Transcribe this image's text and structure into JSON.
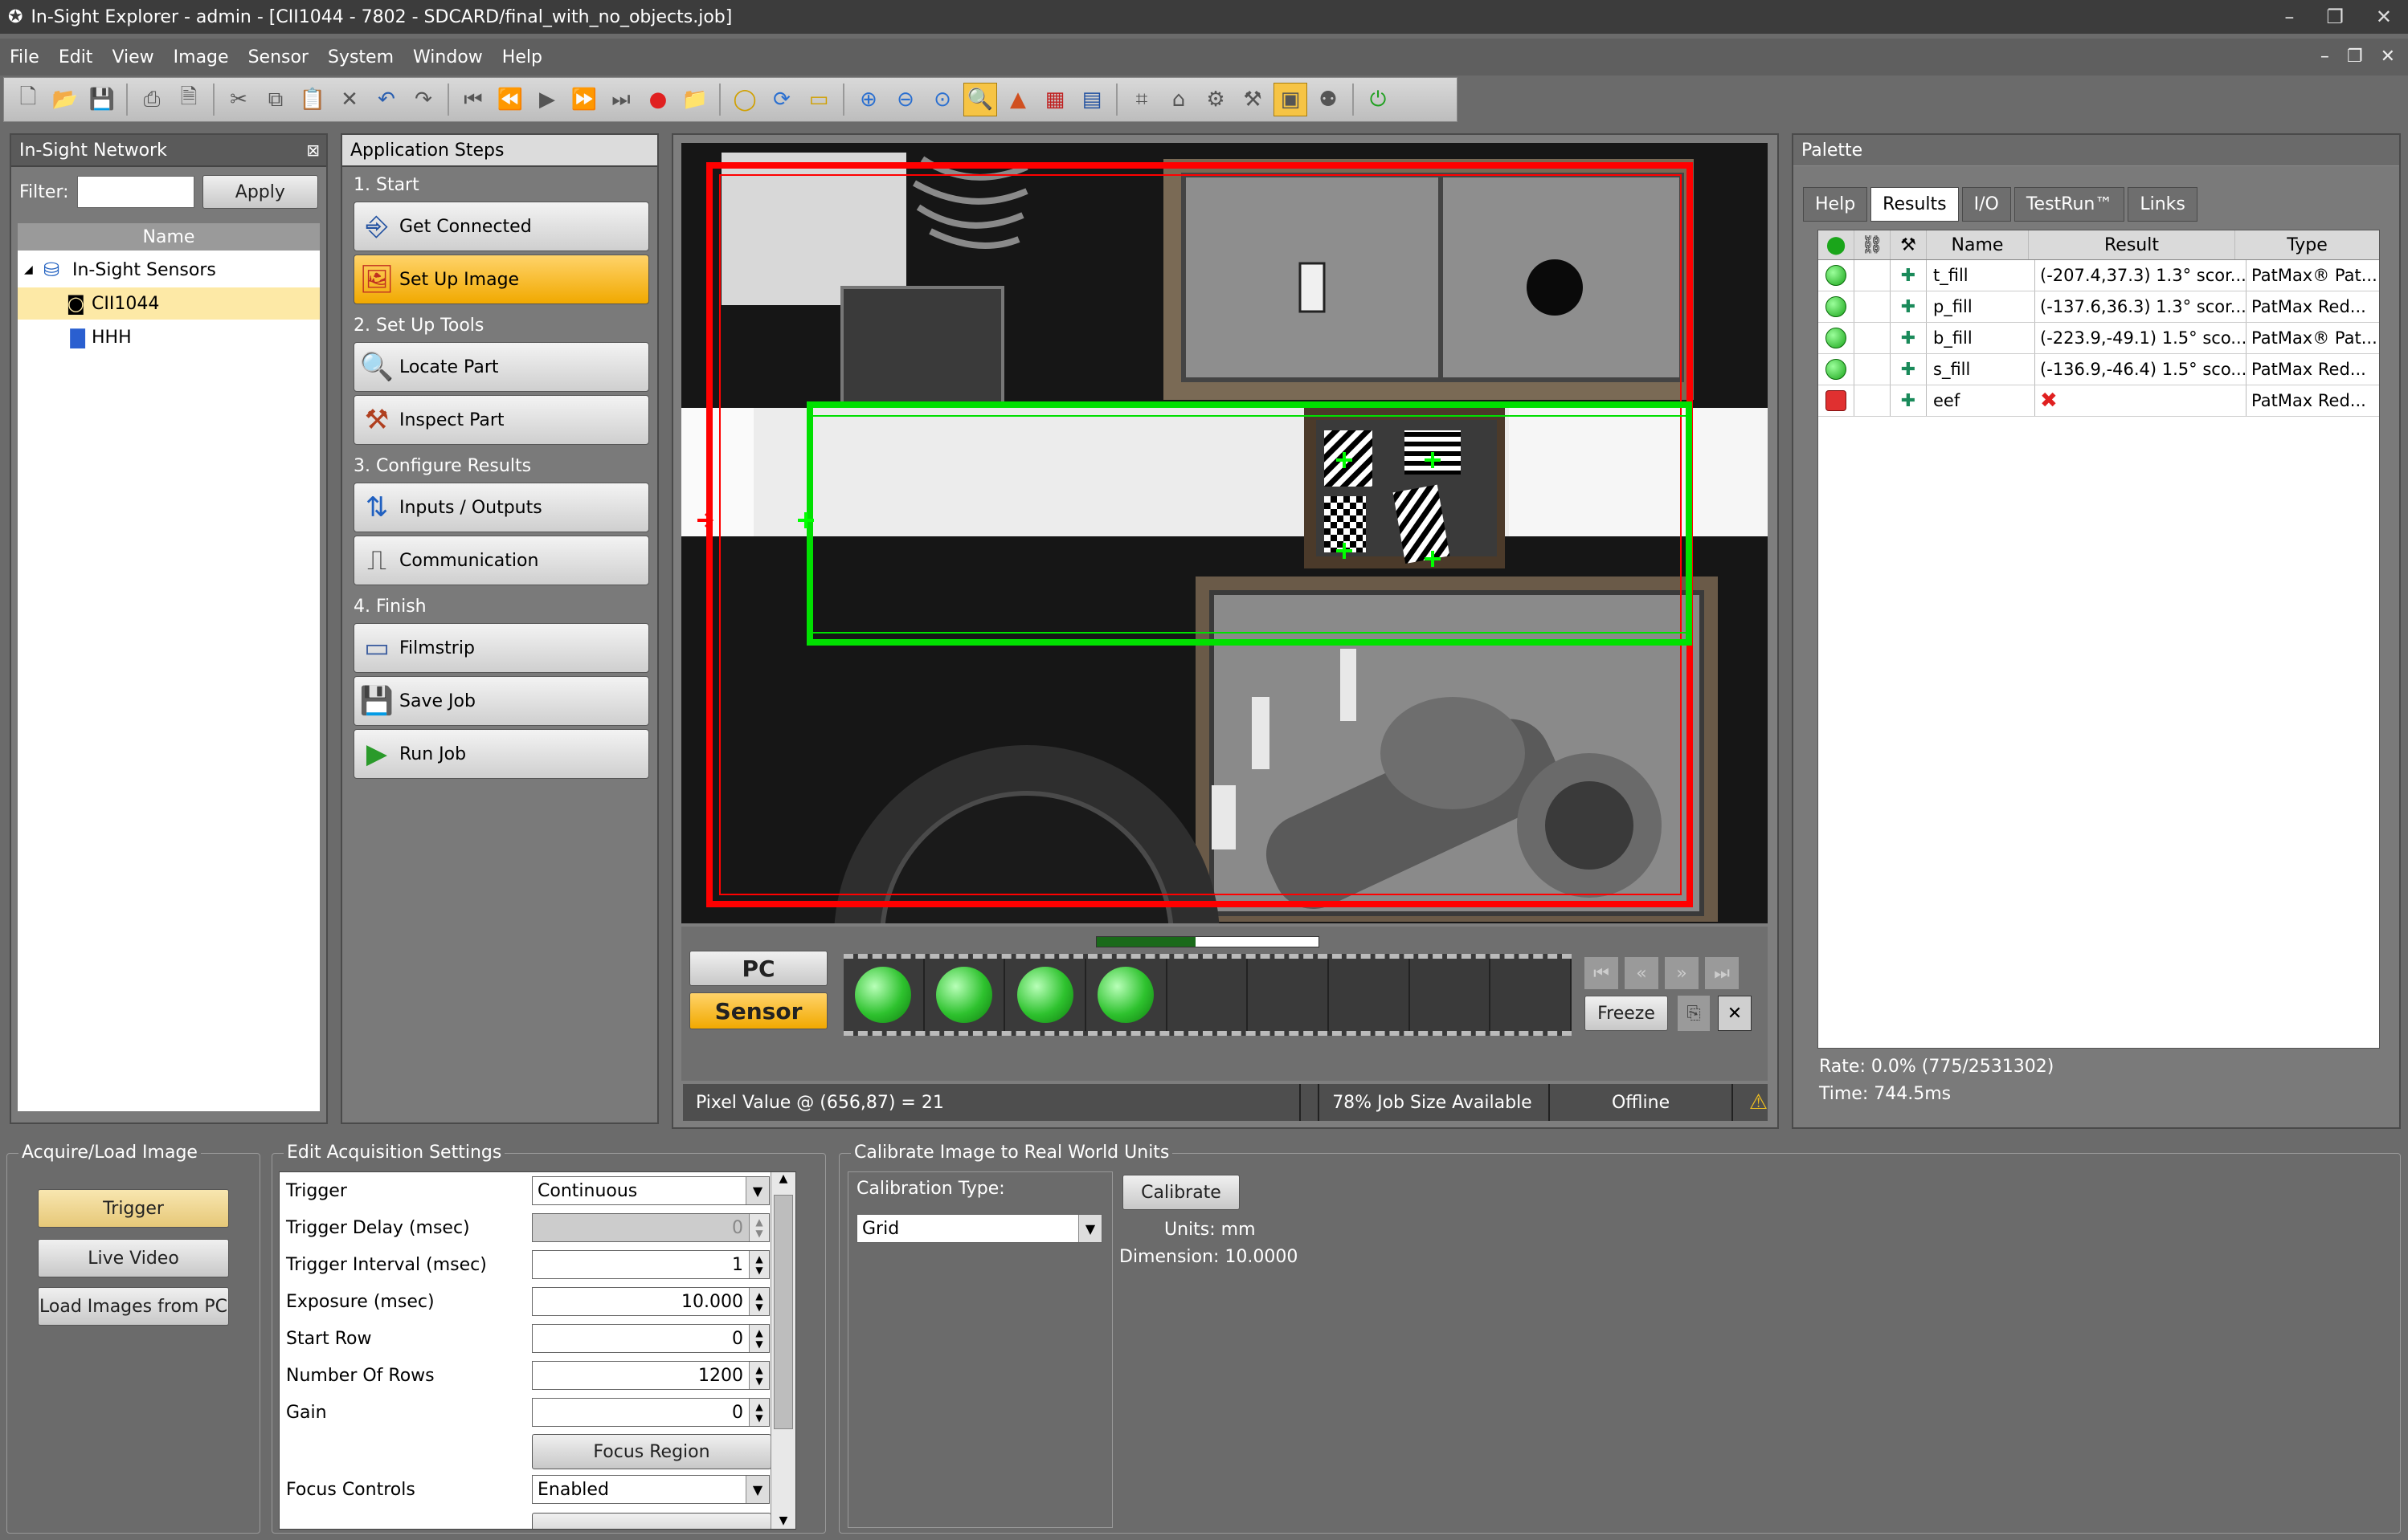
{
  "window": {
    "title": "In-Sight Explorer - admin - [CII1044 - 7802 - SDCARD/final_with_no_objects.job]"
  },
  "menu": [
    "File",
    "Edit",
    "View",
    "Image",
    "Sensor",
    "System",
    "Window",
    "Help"
  ],
  "network": {
    "title": "In-Sight Network",
    "filter_label": "Filter:",
    "filter_value": "",
    "apply": "Apply",
    "col_name": "Name",
    "root": "In-Sight Sensors",
    "items": [
      "CII1044",
      "HHH"
    ]
  },
  "steps": {
    "title": "Application Steps",
    "sections": [
      {
        "label": "1. Start",
        "items": [
          "Get Connected",
          "Set Up Image"
        ]
      },
      {
        "label": "2. Set Up Tools",
        "items": [
          "Locate Part",
          "Inspect Part"
        ]
      },
      {
        "label": "3. Configure Results",
        "items": [
          "Inputs / Outputs",
          "Communication"
        ]
      },
      {
        "label": "4. Finish",
        "items": [
          "Filmstrip",
          "Save Job",
          "Run Job"
        ]
      }
    ],
    "active": "Set Up Image"
  },
  "film": {
    "pc": "PC",
    "sensor": "Sensor",
    "freeze": "Freeze",
    "frames_passed": 4,
    "frames_total": 9
  },
  "status": {
    "pixel": "Pixel Value @ (656,87) = 21",
    "jobsize": "78% Job Size Available",
    "mode": "Offline"
  },
  "palette": {
    "title": "Palette",
    "tabs": [
      "Help",
      "Results",
      "I/O",
      "TestRun™",
      "Links"
    ],
    "selected_tab": "Results",
    "columns": [
      "Name",
      "Result",
      "Type"
    ],
    "rows": [
      {
        "status": "pass",
        "name": "t_fill",
        "result": "(-207.4,37.3) 1.3° scor...",
        "type": "PatMax® Pat..."
      },
      {
        "status": "pass",
        "name": "p_fill",
        "result": "(-137.6,36.3) 1.3° scor...",
        "type": "PatMax Red..."
      },
      {
        "status": "pass",
        "name": "b_fill",
        "result": "(-223.9,-49.1) 1.5° sco...",
        "type": "PatMax® Pat..."
      },
      {
        "status": "pass",
        "name": "s_fill",
        "result": "(-136.9,-46.4) 1.5° sco...",
        "type": "PatMax Red..."
      },
      {
        "status": "fail",
        "name": "eef",
        "result": "✖",
        "type": "PatMax Red..."
      }
    ],
    "rate": "Rate: 0.0% (775/2531302)",
    "time": "Time: 744.5ms"
  },
  "acquire": {
    "title": "Acquire/Load Image",
    "trigger": "Trigger",
    "live": "Live Video",
    "load": "Load Images from PC"
  },
  "edit": {
    "title": "Edit Acquisition Settings",
    "props": [
      {
        "name": "Trigger",
        "value": "Continuous",
        "kind": "select"
      },
      {
        "name": "Trigger Delay (msec)",
        "value": "0",
        "kind": "disabled"
      },
      {
        "name": "Trigger Interval (msec)",
        "value": "1",
        "kind": "num"
      },
      {
        "name": "Exposure (msec)",
        "value": "10.000",
        "kind": "num"
      },
      {
        "name": "Start Row",
        "value": "0",
        "kind": "num"
      },
      {
        "name": "Number Of Rows",
        "value": "1200",
        "kind": "num"
      },
      {
        "name": "Gain",
        "value": "0",
        "kind": "num"
      }
    ],
    "focus_region": "Focus Region",
    "focus_controls_label": "Focus Controls",
    "focus_controls_value": "Enabled"
  },
  "calib": {
    "title": "Calibrate Image to Real World Units",
    "type_label": "Calibration Type:",
    "type_value": "Grid",
    "calibrate": "Calibrate",
    "units": "Units:  mm",
    "dimension": "Dimension:  10.0000"
  },
  "colors": {
    "accent": "#f1a900",
    "pass": "#1aa51a",
    "fail": "#e03030",
    "roi_red": "#ff0000",
    "roi_green": "#00e000"
  }
}
